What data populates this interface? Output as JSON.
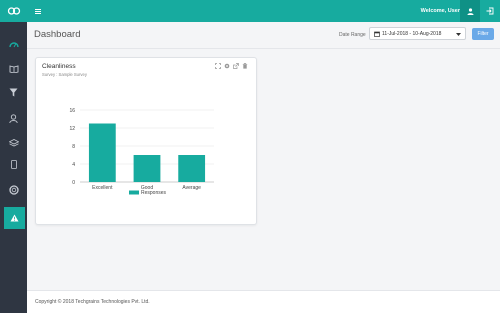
{
  "header": {
    "welcome": "Welcome, User",
    "logo_icon": "logo-icon",
    "menu_icon": "hamburger-icon",
    "user_icon": "user-icon",
    "logout_icon": "logout-icon",
    "accent": "#17ab9f"
  },
  "sidebar": {
    "items": [
      {
        "icon": "dashboard-icon"
      },
      {
        "icon": "book-icon"
      },
      {
        "icon": "filter-icon"
      },
      {
        "icon": "user-icon"
      },
      {
        "icon": "layers-icon"
      },
      {
        "icon": "mobile-icon"
      },
      {
        "icon": "lifebuoy-icon"
      },
      {
        "icon": "warning-icon"
      }
    ]
  },
  "page": {
    "title": "Dashboard",
    "date_range_label": "Date Range",
    "date_range_value": "11-Jul-2018 - 10-Aug-2018",
    "filter_label": "Filter"
  },
  "card": {
    "title": "Cleanliness",
    "subtitle": "Survey : Sample Survey",
    "tools": [
      "expand-icon",
      "gear-icon",
      "external-link-icon",
      "trash-icon"
    ]
  },
  "chart_data": {
    "type": "bar",
    "categories": [
      "Excellent",
      "Good",
      "Average"
    ],
    "series": [
      {
        "name": "Responses",
        "values": [
          13,
          6,
          6
        ],
        "color": "#17ab9f"
      }
    ],
    "yticks": [
      0,
      4,
      8,
      12,
      16
    ],
    "ylim": [
      0,
      16
    ],
    "legend": "bottom",
    "grid": true
  },
  "footer": {
    "text": "Copyright © 2018 Techgrains Technologies Pvt. Ltd."
  }
}
